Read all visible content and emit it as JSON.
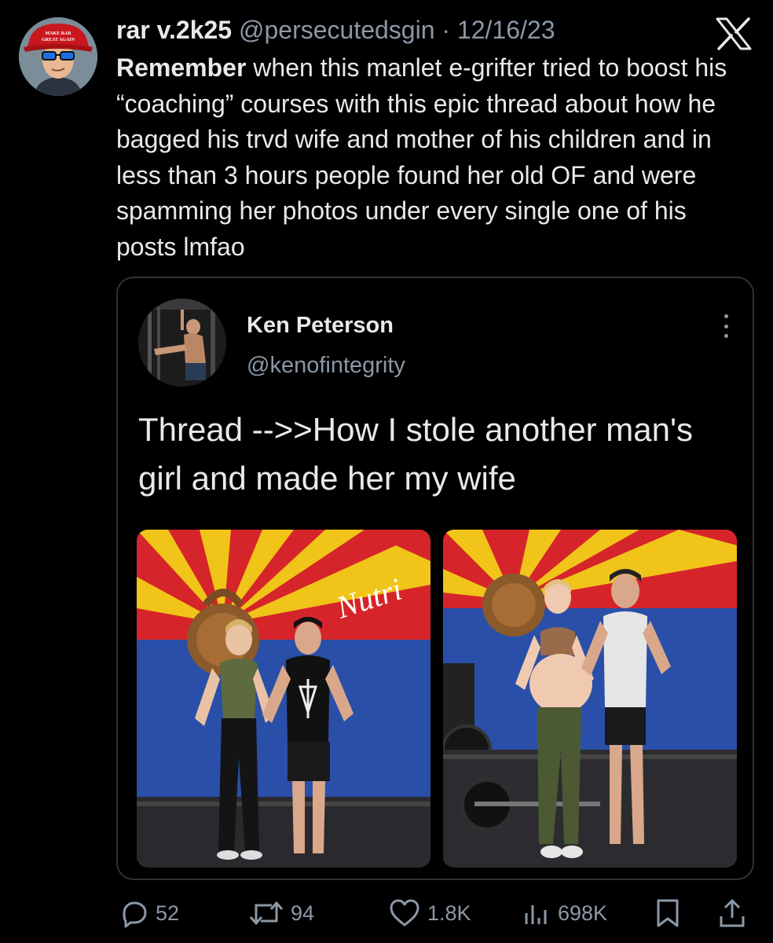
{
  "tweet": {
    "author": {
      "display_name": "rar v.2k25",
      "handle": "@persecutedsgin",
      "avatar_icon": "avatar-cartoon-icon",
      "avatar_cap_text": "MAKE RAR GREAT AGAIN"
    },
    "separator": "·",
    "date": "12/16/23",
    "text_bold": "Remember",
    "text_rest": " when this manlet e-grifter tried to boost his “coaching” courses with this epic thread about how he bagged his trvd wife and mother of his children and in less than 3 hours people found her old OF and were spamming her photos under every single one of his posts lmfao",
    "platform_icon": "x-logo-icon"
  },
  "quote": {
    "display_name": "Ken Peterson",
    "handle": "@kenofintegrity",
    "text": "Thread -->>How I stole another man's girl and made her my wife",
    "more_icon": "vertical-ellipsis-icon",
    "photos": [
      {
        "name": "gym-photo-1"
      },
      {
        "name": "gym-photo-2"
      }
    ],
    "wall_text": "Nutri"
  },
  "actions": {
    "replies": "52",
    "reposts": "94",
    "likes": "1.8K",
    "views": "698K"
  },
  "colors": {
    "background": "#000000",
    "text_primary": "#e7e9ea",
    "text_secondary": "#8b98a5",
    "border": "#2f3336"
  }
}
